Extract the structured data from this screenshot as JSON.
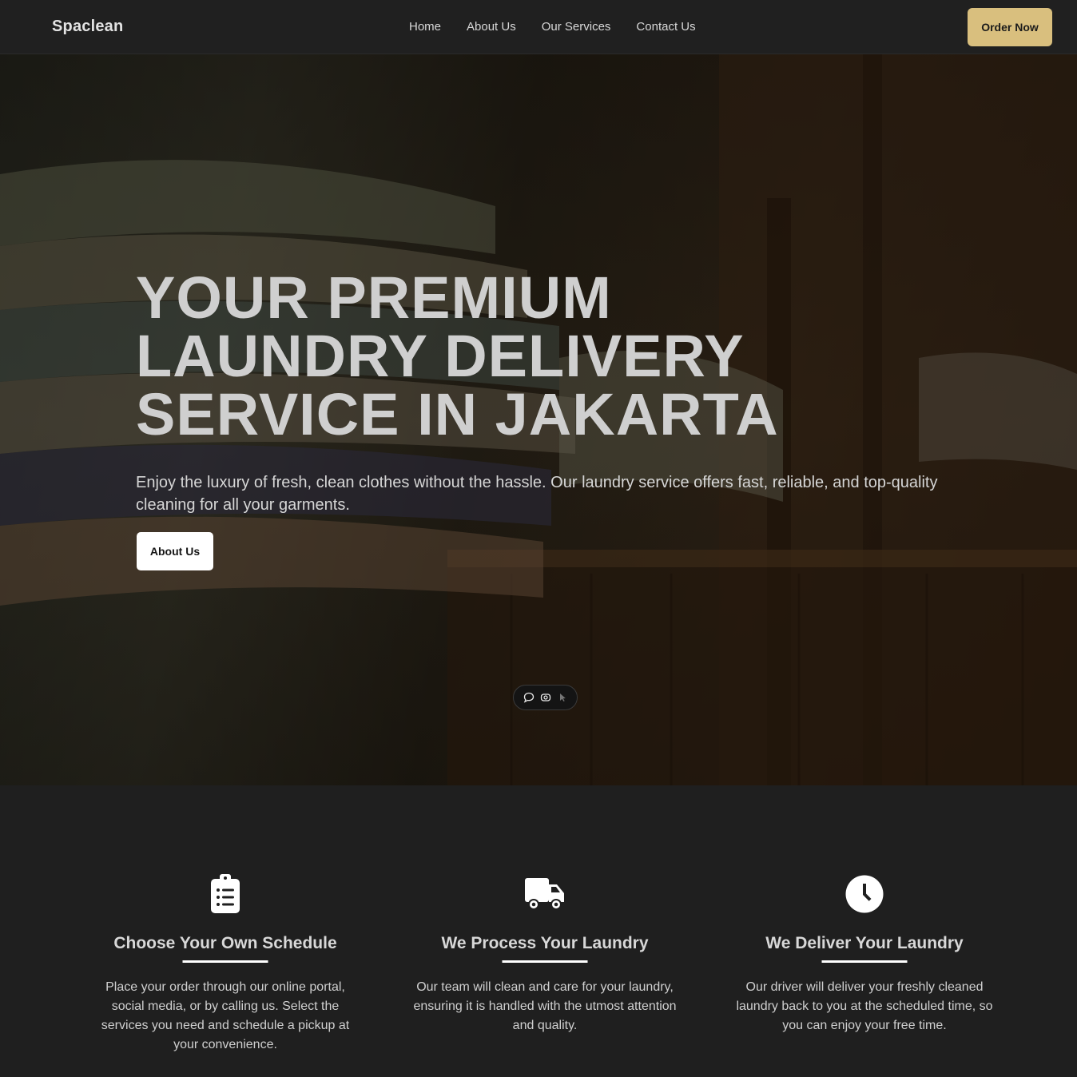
{
  "nav": {
    "brand": "Spaclean",
    "links": [
      "Home",
      "About Us",
      "Our Services",
      "Contact Us"
    ],
    "order_button": "Order Now",
    "accent_color": "#d9bf7e"
  },
  "hero": {
    "title_lines": [
      "YOUR PREMIUM",
      "LAUNDRY DELIVERY",
      "SERVICE IN JAKARTA"
    ],
    "subtitle": "Enjoy the luxury of fresh, clean clothes without the hassle. Our laundry service offers fast, reliable, and top-quality cleaning for all your garments.",
    "button": "About Us",
    "widget_icons": [
      "chat-icon",
      "eye-icon",
      "pointer-icon"
    ]
  },
  "features": [
    {
      "icon": "clipboard-list-icon",
      "title": "Choose Your Own Schedule",
      "text": "Place your order through our online portal, social media, or by calling us. Select the services you need and schedule a pickup at your convenience."
    },
    {
      "icon": "truck-icon",
      "title": "We Process Your Laundry",
      "text": "Our team will clean and care for your laundry, ensuring it is handled with the utmost attention and quality."
    },
    {
      "icon": "clock-icon",
      "title": "We Deliver Your Laundry",
      "text": "Our driver will deliver your freshly cleaned laundry back to you at the scheduled time, so you can enjoy your free time."
    }
  ]
}
